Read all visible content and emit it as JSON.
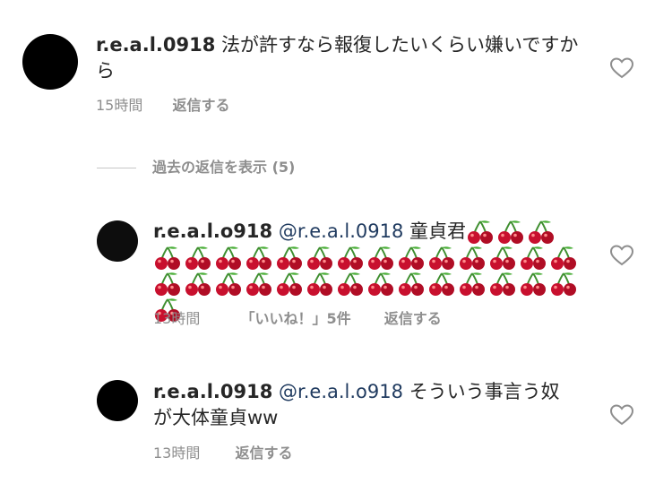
{
  "comments": [
    {
      "username": "r.e.a.l.0918",
      "text": "法が許すなら報復したいくらい嫌いですから",
      "time": "15時間",
      "reply_label": "返信する"
    },
    {
      "username": "r.e.a.l.o918",
      "mention": "@r.e.a.l.0918",
      "text": "童貞君",
      "emoji_count": 32,
      "emoji_name": "cherry-emoji",
      "time": "13時間",
      "likes_label": "「いいね！」5件",
      "reply_label": "返信する"
    },
    {
      "username": "r.e.a.l.0918",
      "mention": "@r.e.a.l.o918",
      "text": "そういう事言う奴が大体童貞ww",
      "time": "13時間",
      "reply_label": "返信する"
    }
  ],
  "view_replies": {
    "label": "過去の返信を表示",
    "count": "(5)"
  },
  "icons": {
    "like": "heart-outline-icon"
  },
  "colors": {
    "text": "#262626",
    "muted": "#8e8e8e",
    "mention": "#1f3a5f"
  }
}
